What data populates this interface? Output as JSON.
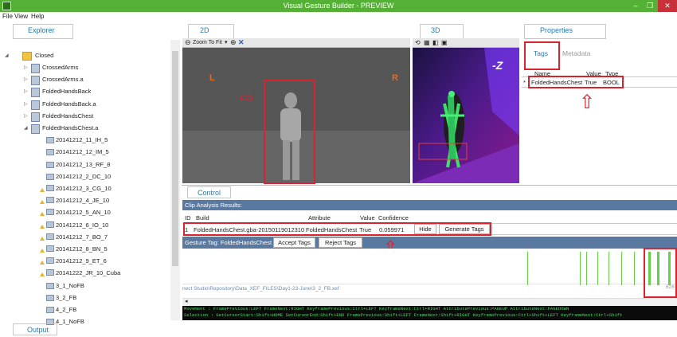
{
  "window": {
    "title": "Visual Gesture Builder - PREVIEW",
    "minimize": "–",
    "maximize": "❐",
    "close": "✕"
  },
  "menu": [
    "File",
    "View",
    "Help"
  ],
  "panels": {
    "explorer": "Explorer",
    "view2d": "2D",
    "view3d": "3D",
    "properties": "Properties",
    "output": "Output"
  },
  "view2d": {
    "toolbar_label": "Zoom To Fit",
    "marker_left": "L",
    "marker_right": "R"
  },
  "view3d": {
    "marker": "-Z"
  },
  "tree": {
    "root": "Closed",
    "items": [
      {
        "label": "CrossedArms",
        "type": "file",
        "level": 1
      },
      {
        "label": "CrossedArms.a",
        "type": "file",
        "level": 1
      },
      {
        "label": "FoldedHandsBack",
        "type": "file",
        "level": 1
      },
      {
        "label": "FoldedHandsBack.a",
        "type": "file",
        "level": 1
      },
      {
        "label": "FoldedHandsChest",
        "type": "file",
        "level": 1
      },
      {
        "label": "FoldedHandsChest.a",
        "type": "file",
        "level": 1
      },
      {
        "label": "20141212_11_IH_5",
        "type": "clip",
        "level": 2
      },
      {
        "label": "20141212_12_IM_5",
        "type": "clip",
        "level": 2
      },
      {
        "label": "20141212_13_RF_8",
        "type": "clip",
        "level": 2
      },
      {
        "label": "20141212_2_DC_10",
        "type": "clip",
        "level": 2
      },
      {
        "label": "20141212_3_CG_10",
        "type": "warn",
        "level": 2
      },
      {
        "label": "20141212_4_JE_10",
        "type": "warn",
        "level": 2
      },
      {
        "label": "20141212_5_AN_10",
        "type": "warn",
        "level": 2
      },
      {
        "label": "20141212_6_IO_10",
        "type": "warn",
        "level": 2
      },
      {
        "label": "20141212_7_BO_7",
        "type": "warn",
        "level": 2
      },
      {
        "label": "20141212_8_BN_5",
        "type": "warn",
        "level": 2
      },
      {
        "label": "20141212_9_ET_6",
        "type": "warn",
        "level": 2
      },
      {
        "label": "20141222_JR_10_Cuba",
        "type": "warn",
        "level": 2
      },
      {
        "label": "3_1_NoFB",
        "type": "clip",
        "level": 2
      },
      {
        "label": "3_2_FB",
        "type": "clip",
        "level": 2
      },
      {
        "label": "4_2_FB",
        "type": "clip",
        "level": 2
      },
      {
        "label": "4_1_NoFB",
        "type": "clip",
        "level": 2
      }
    ]
  },
  "properties": {
    "tabs": [
      "Tags",
      "Metadata"
    ],
    "columns": [
      "Name",
      "Value",
      "Type"
    ],
    "row": {
      "marker": "*",
      "name": "FoldedHandsChest",
      "value": "True",
      "type": "BOOL"
    }
  },
  "control": {
    "tab": "Control",
    "clip_header": "Clip Analysis Results:",
    "columns": [
      "ID",
      "Build",
      "Attribute",
      "Value",
      "Confidence"
    ],
    "row": {
      "id": "1",
      "build": "FoldedHandsChest.gba-20150119012310",
      "attribute": "FoldedHandsChest",
      "value": "True",
      "confidence": "0.059971"
    },
    "hide_label": "Hide",
    "generate_label": "Generate Tags",
    "gesture_tag": "Gesture Tag: FoldedHandsChest",
    "accept_label": "Accept Tags",
    "reject_label": "Reject Tags",
    "path": "nect Studio\\Repository\\Data_XEF_FILES\\Day1-23-June\\3_2_FB.xef",
    "frame": "628",
    "status_line1": "Movement  :  FramePrevious:LEFT FrameNext:RIGHT KeyframePrevious:Ctrl+LEFT KeyframeNext:Ctrl+RIGHT AttributePrevious:PAGEUP AttributeNext:PAGEDOWN",
    "status_line2": "Selection  :  SetCursorStart:Shift+HOME SetCursorEnd:Shift+END FramePrevious:Shift+LEFT FrameNext:Shift+RIGHT KeyframePrevious:Ctrl+Shift+LEFT KeyframeNext:Ctrl+Shift"
  },
  "colors": {
    "titlebar": "#55b135",
    "accent_blue": "#2a7ab0",
    "header_blue": "#5979a0",
    "annotation_red": "#d9232e",
    "tag_green": "#66d04b"
  }
}
